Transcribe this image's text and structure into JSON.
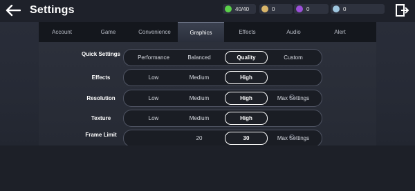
{
  "header": {
    "title": "Settings",
    "currencies": [
      {
        "icon": "energy-icon",
        "value": "40/40",
        "color": "#5bd14a"
      },
      {
        "icon": "gold-coin-icon",
        "value": "0",
        "color": "#d8b56a"
      },
      {
        "icon": "purple-gem-icon",
        "value": "0",
        "color": "#9b4fd8"
      },
      {
        "icon": "silver-gem-icon",
        "value": "0",
        "color": "#9fc7e0"
      }
    ]
  },
  "tabs": [
    {
      "label": "Account"
    },
    {
      "label": "Game"
    },
    {
      "label": "Convenience"
    },
    {
      "label": "Graphics",
      "active": true
    },
    {
      "label": "Effects"
    },
    {
      "label": "Audio"
    },
    {
      "label": "Alert"
    }
  ],
  "settings": {
    "quick": {
      "label": "Quick Settings",
      "options": [
        "Performance",
        "Balanced",
        "Quality",
        "Custom"
      ],
      "selected": "Quality"
    },
    "effects": {
      "label": "Effects",
      "options": [
        "Low",
        "Medium",
        "High"
      ],
      "selected": "High"
    },
    "resolution": {
      "label": "Resolution",
      "options": [
        "Low",
        "Medium",
        "High",
        "Max Settings"
      ],
      "selected": "High"
    },
    "texture": {
      "label": "Texture",
      "options": [
        "Low",
        "Medium",
        "High"
      ],
      "selected": "High"
    },
    "frame_limit": {
      "label": "Frame Limit",
      "options": [
        "20",
        "30",
        "Max Settings"
      ],
      "selected": "30"
    }
  },
  "colors": {
    "accent_selected": "#ffffff",
    "panel_bg": "#2c303b",
    "tab_bg": "#14171d"
  }
}
